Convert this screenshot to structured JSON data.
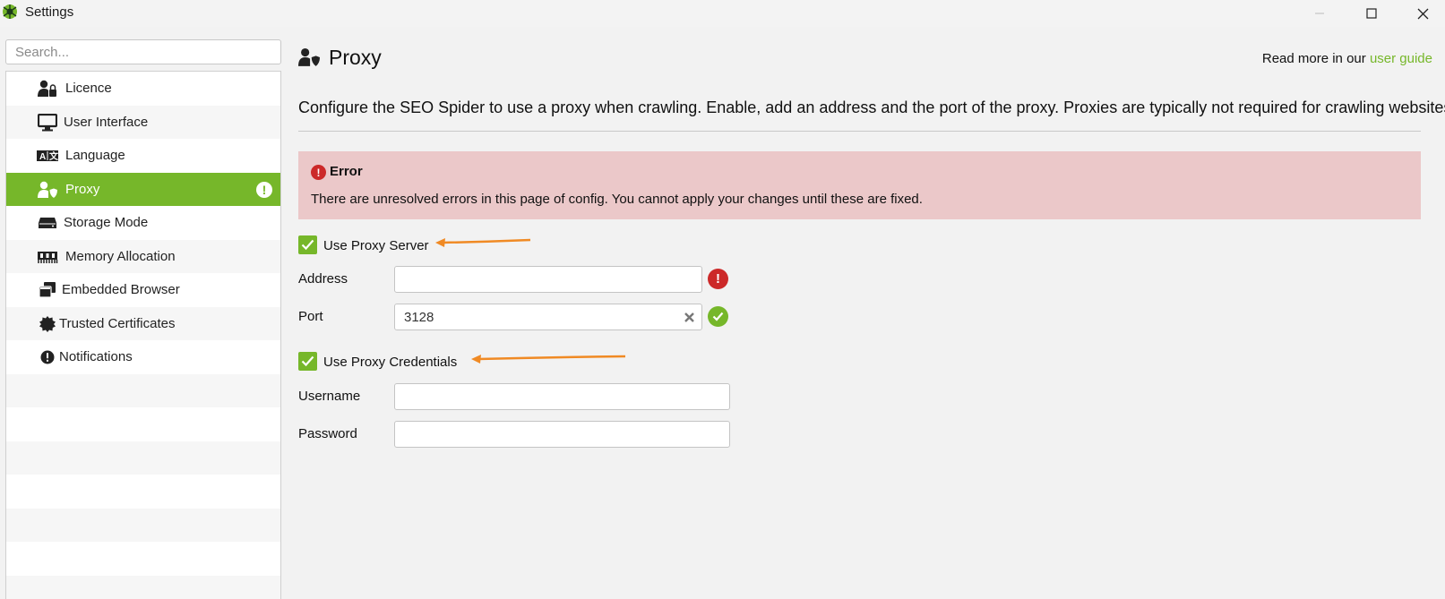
{
  "window": {
    "title": "Settings",
    "icon": "spider-logo-icon",
    "controls": [
      "minimize-icon",
      "maximize-icon",
      "close-icon"
    ]
  },
  "search": {
    "placeholder": "Search...",
    "value": ""
  },
  "sidebar": {
    "items": [
      {
        "label": "Licence",
        "icon": "user-lock-icon"
      },
      {
        "label": "User Interface",
        "icon": "monitor-icon"
      },
      {
        "label": "Language",
        "icon": "language-icon"
      },
      {
        "label": "Proxy",
        "icon": "user-shield-icon",
        "active": true,
        "badge": "!"
      },
      {
        "label": "Storage Mode",
        "icon": "hard-drive-icon"
      },
      {
        "label": "Memory Allocation",
        "icon": "memory-icon"
      },
      {
        "label": "Embedded Browser",
        "icon": "windows-icon"
      },
      {
        "label": "Trusted Certificates",
        "icon": "certificate-icon"
      },
      {
        "label": "Notifications",
        "icon": "exclamation-circle-icon"
      }
    ]
  },
  "header": {
    "title": "Proxy",
    "icon": "user-shield-icon",
    "read_more_prefix": "Read more in our",
    "read_more_link": "user guide"
  },
  "description": "Configure the SEO Spider to use a proxy when crawling. Enable, add an address and the port of the proxy. Proxies are typically not required for crawling websites.",
  "error": {
    "title": "Error",
    "message": "There are unresolved errors in this page of config. You cannot apply your changes until these are fixed."
  },
  "form": {
    "use_proxy_server": {
      "label": "Use Proxy Server",
      "checked": true
    },
    "address": {
      "label": "Address",
      "value": "",
      "status": "error"
    },
    "port": {
      "label": "Port",
      "value": "3128",
      "status": "valid"
    },
    "use_proxy_credentials": {
      "label": "Use Proxy Credentials",
      "checked": true
    },
    "username": {
      "label": "Username",
      "value": ""
    },
    "password": {
      "label": "Password",
      "value": ""
    }
  },
  "colors": {
    "accent": "#76b72a",
    "error_bg": "#ebc8c9",
    "error_icon": "#cc2929",
    "annotation_arrow": "#f08a24"
  }
}
